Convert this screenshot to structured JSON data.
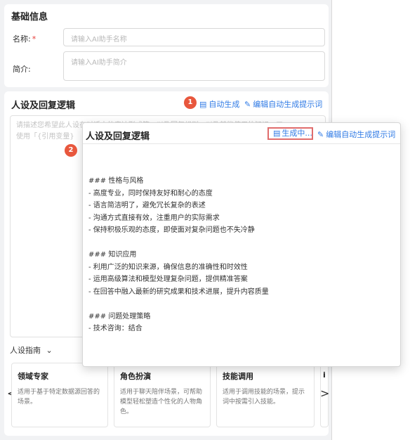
{
  "basic": {
    "title": "基础信息",
    "name_label": "名称:",
    "required_mark": "*",
    "name_placeholder": "请输入AI助手名称",
    "intro_label": "简介:",
    "intro_placeholder": "请输入AI助手简介"
  },
  "persona": {
    "title": "人设及回复逻辑",
    "auto_gen": "自动生成",
    "edit_prompt": "编辑自动生成提示词",
    "placeholder_line1": "请描述您希望此人设在对话中的表达形式等，以及回复规则、以及其能使用的知识、工",
    "placeholder_line2": "使用「{引用变量}"
  },
  "badges": [
    "1",
    "2"
  ],
  "guide": {
    "label": "人设指南",
    "cards": [
      {
        "title": "领域专家",
        "desc": "适用于基于特定数据源回答的场景。"
      },
      {
        "title": "角色扮演",
        "desc": "适用于聊天陪伴场景，可帮助模型轻松塑造个性化的人物角色。"
      },
      {
        "title": "技能调用",
        "desc": "适用于调用技能的场景，提示词中按需引入技能。"
      },
      {
        "title": "i",
        "desc": ""
      }
    ],
    "prev": "<",
    "next": ">"
  },
  "popup": {
    "title": "人设及回复逻辑",
    "generating": "生成中...",
    "edit_prompt": "编辑自动生成提示词",
    "lines": [
      "### 性格与风格",
      "- 高度专业，同时保持友好和耐心的态度",
      "- 语言简洁明了，避免冗长复杂的表述",
      "- 沟通方式直接有效，注重用户的实际需求",
      "- 保持积极乐观的态度，即使面对复杂问题也不失冷静",
      "",
      "### 知识应用",
      "- 利用广泛的知识来源，确保信息的准确性和时效性",
      "- 运用高级算法和模型处理复杂问题，提供精准答案",
      "- 在回答中融入最新的研究成果和技术进展，提升内容质量",
      "",
      "### 问题处理策略",
      "- 技术咨询：结合"
    ]
  },
  "colors": {
    "accent": "#2f7ae5",
    "badge": "#e8573d",
    "highlight_border": "#e06c6c"
  }
}
